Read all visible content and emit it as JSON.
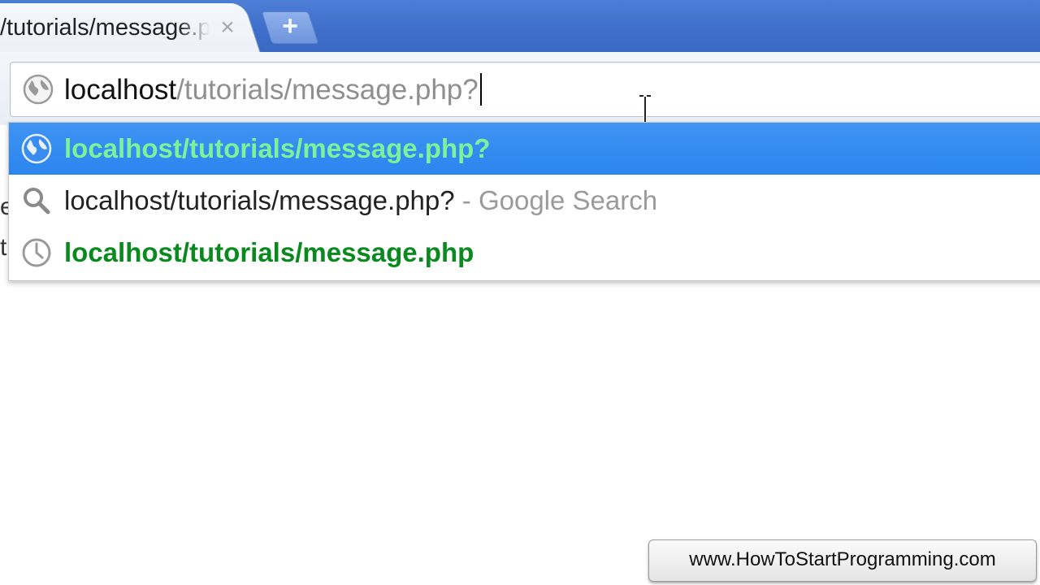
{
  "tab": {
    "title": "/tutorials/message.php?",
    "close_glyph": "×",
    "new_tab_glyph": "+"
  },
  "omnibox": {
    "host": "localhost",
    "path": "/tutorials/message.php?",
    "icon": "globe-icon"
  },
  "suggestions": [
    {
      "icon": "globe-icon",
      "url": "localhost/tutorials/message.php?",
      "selected": true
    },
    {
      "icon": "search-icon",
      "query": "localhost/tutorials/message.php?",
      "description": " - Google Search",
      "selected": false
    },
    {
      "icon": "history-clock-icon",
      "url": "localhost/tutorials/message.php",
      "selected": false
    }
  ],
  "page": {
    "fragments": [
      "e",
      "t"
    ]
  },
  "watermark": {
    "text": "www.HowToStartProgramming.com"
  },
  "colors": {
    "tabstrip": "#3e6fcb",
    "selected_row": "#2b86ef",
    "url_green": "#0a8a1e",
    "url_green_light": "#7ef29a"
  }
}
